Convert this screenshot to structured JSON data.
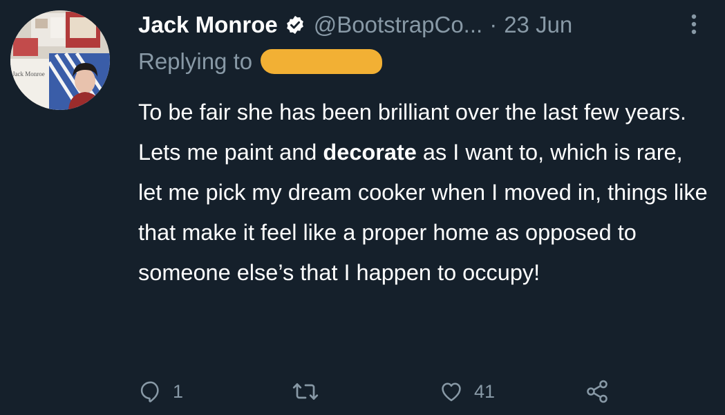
{
  "tweet": {
    "author_name": "Jack Monroe",
    "handle": "@BootstrapCo...",
    "separator": "·",
    "date": "23 Jun",
    "replying_to_label": "Replying to",
    "avatar_caption": "Jack Monroe",
    "text_before_bold": "To be fair she has been brilliant over the last few years. Lets me paint and ",
    "text_bold": "decorate",
    "text_after_bold": " as I want to, which is rare, let me pick my dream cooker when I moved in, things like that make it feel like a proper home as opposed to someone else’s that I happen to occupy!"
  },
  "actions": {
    "reply_count": "1",
    "retweet_count": "",
    "like_count": "41"
  },
  "icons": {
    "verified": "verified-badge-icon",
    "more": "more-vertical-icon",
    "reply": "reply-icon",
    "retweet": "retweet-icon",
    "like": "heart-icon",
    "share": "share-icon"
  },
  "colors": {
    "background": "#15202b",
    "text": "#ffffff",
    "secondary_text": "#8899a6",
    "redaction": "#f2b034"
  }
}
